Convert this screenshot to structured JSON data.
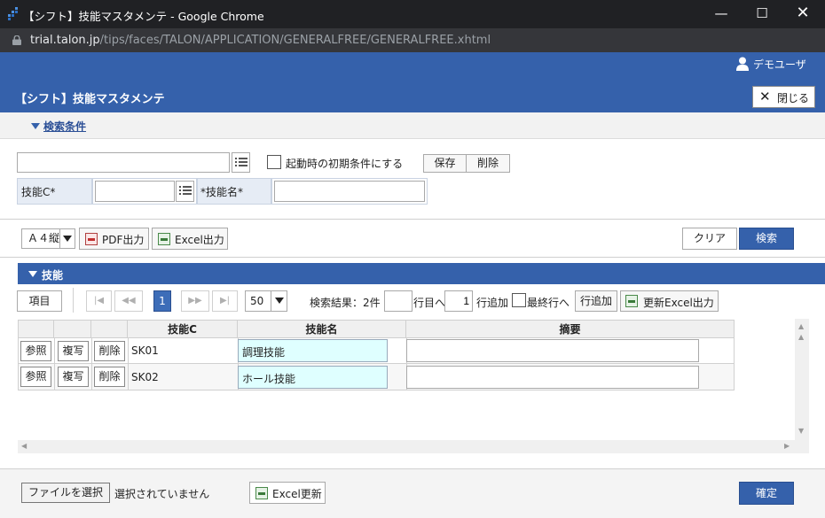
{
  "window": {
    "title": "【シフト】技能マスタメンテ - Google Chrome",
    "url_host": "trial.talon.jp",
    "url_path": "/tips/faces/TALON/APPLICATION/GENERALFREE/GENERALFREE.xhtml"
  },
  "header": {
    "user": "デモユーザ",
    "page_title": "【シフト】技能マスタメンテ",
    "close_label": "閉じる"
  },
  "conditions": {
    "toggle_label": "検索条件",
    "preset_value": "",
    "startup_checkbox_label": "起動時の初期条件にする",
    "startup_checked": false,
    "save_label": "保存",
    "delete_label": "削除",
    "skill_code_label": "技能C*",
    "skill_code_value": "",
    "skill_name_label": "*技能名*",
    "skill_name_value": ""
  },
  "toolbar": {
    "paper_size": "Ａ４縦",
    "pdf_label": "PDF出力",
    "excel_label": "Excel出力",
    "clear_label": "クリア",
    "search_label": "検索"
  },
  "section": {
    "title": "技能",
    "items_label": "項目",
    "current_page": "1",
    "page_size": "50",
    "result_label": "検索結果：2件",
    "goto_row_value": "",
    "goto_row_label": "行目へ",
    "add_count": "1",
    "add_rows_label": "行追加",
    "last_row_label": "最終行へ",
    "add_row_btn": "行追加",
    "update_excel_label": "更新Excel出力"
  },
  "grid": {
    "columns": [
      "技能C",
      "技能名",
      "摘要"
    ],
    "row_buttons": [
      "参照",
      "複写",
      "削除"
    ],
    "rows": [
      {
        "code": "SK01",
        "name": "調理技能",
        "note": ""
      },
      {
        "code": "SK02",
        "name": "ホール技能",
        "note": ""
      }
    ]
  },
  "footer": {
    "file_button": "ファイルを選択",
    "file_status": "選択されていません",
    "excel_update_label": "Excel更新",
    "confirm_label": "確定"
  },
  "colors": {
    "brand": "#3561ab",
    "input_highlight": "#dfffff"
  }
}
